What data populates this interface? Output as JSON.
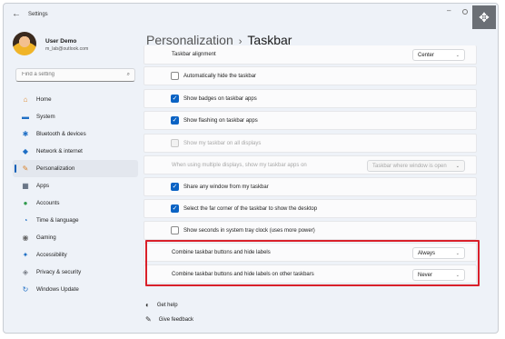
{
  "app": {
    "title": "Settings",
    "back_icon": "back-arrow-icon"
  },
  "user": {
    "name": "User Demo",
    "email": "m_lab@outlook.com"
  },
  "search": {
    "placeholder": "Find a setting"
  },
  "sidebar": {
    "items": [
      {
        "label": "Home",
        "icon": "home-icon",
        "glyph": "⌂",
        "color": "#e0892a"
      },
      {
        "label": "System",
        "icon": "system-icon",
        "glyph": "▬",
        "color": "#1f6fc5"
      },
      {
        "label": "Bluetooth & devices",
        "icon": "bluetooth-icon",
        "glyph": "✱",
        "color": "#1f6fc5"
      },
      {
        "label": "Network & internet",
        "icon": "network-icon",
        "glyph": "◆",
        "color": "#1f6fc5"
      },
      {
        "label": "Personalization",
        "icon": "brush-icon",
        "glyph": "✎",
        "color": "#d9822b",
        "active": true
      },
      {
        "label": "Apps",
        "icon": "apps-icon",
        "glyph": "▦",
        "color": "#3b4a5e"
      },
      {
        "label": "Accounts",
        "icon": "accounts-icon",
        "glyph": "●",
        "color": "#2f9a4c"
      },
      {
        "label": "Time & language",
        "icon": "globe-clock-icon",
        "glyph": "◔",
        "color": "#1f6fc5"
      },
      {
        "label": "Gaming",
        "icon": "gaming-icon",
        "glyph": "◉",
        "color": "#666666"
      },
      {
        "label": "Accessibility",
        "icon": "accessibility-icon",
        "glyph": "✦",
        "color": "#1f6fc5"
      },
      {
        "label": "Privacy & security",
        "icon": "shield-icon",
        "glyph": "◈",
        "color": "#7a7f88"
      },
      {
        "label": "Windows Update",
        "icon": "update-icon",
        "glyph": "↻",
        "color": "#1f6fc5"
      }
    ]
  },
  "breadcrumb": {
    "parent": "Personalization",
    "separator": "›",
    "current": "Taskbar"
  },
  "settings": {
    "alignment": {
      "label": "Taskbar alignment",
      "value": "Center"
    },
    "auto_hide": {
      "label": "Automatically hide the taskbar",
      "checked": false
    },
    "badges": {
      "label": "Show badges on taskbar apps",
      "checked": true
    },
    "flashing": {
      "label": "Show flashing on taskbar apps",
      "checked": true
    },
    "all_displays": {
      "label": "Show my taskbar on all displays",
      "checked": false,
      "disabled": true
    },
    "multi_display": {
      "label": "When using multiple displays, show my taskbar apps on",
      "value": "Taskbar where window is open",
      "disabled": true
    },
    "share_window": {
      "label": "Share any window from my taskbar",
      "checked": true
    },
    "far_corner": {
      "label": "Select the far corner of the taskbar to show the desktop",
      "checked": true
    },
    "seconds": {
      "label": "Show seconds in system tray clock (uses more power)",
      "checked": false
    },
    "combine": {
      "label": "Combine taskbar buttons and hide labels",
      "value": "Always"
    },
    "combine_other": {
      "label": "Combine taskbar buttons and hide labels on other taskbars",
      "value": "Never"
    }
  },
  "links": {
    "help": "Get help",
    "feedback": "Give feedback"
  },
  "colors": {
    "accent": "#0b63c4",
    "highlight": "#d9202a"
  }
}
